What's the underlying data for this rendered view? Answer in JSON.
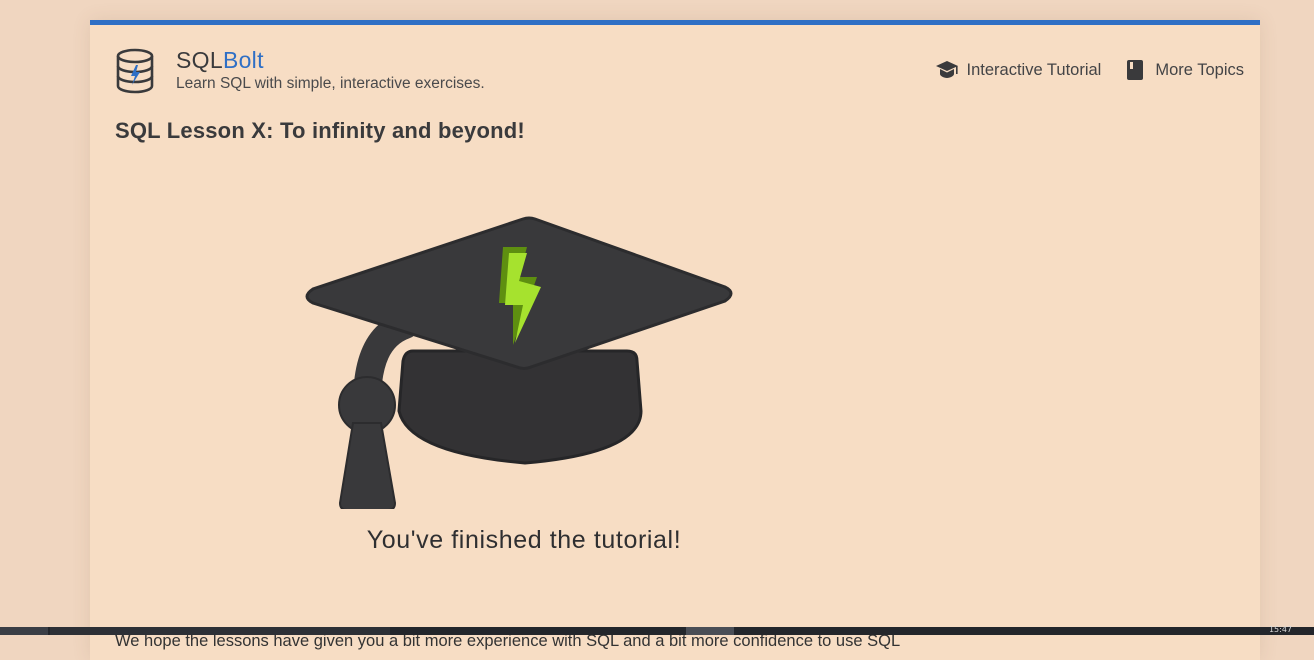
{
  "brand": {
    "title_part1": "SQL",
    "title_part2": "Bolt",
    "subtitle": "Learn SQL with simple, interactive exercises.",
    "accent_color": "#2f6fc5",
    "logo_icon": "database-bolt-icon"
  },
  "nav": {
    "items": [
      {
        "label": "Interactive Tutorial",
        "icon": "graduation-cap-icon"
      },
      {
        "label": "More Topics",
        "icon": "book-icon"
      }
    ]
  },
  "lesson": {
    "title": "SQL Lesson X: To infinity and beyond!",
    "illustration_icon": "graduation-cap-bolt-icon",
    "finished_text": "You've finished the tutorial!",
    "body_intro": "We hope the lessons have given you a bit more experience with SQL and a bit more confidence to use SQL"
  },
  "taskbar": {
    "clock": "15:47"
  }
}
